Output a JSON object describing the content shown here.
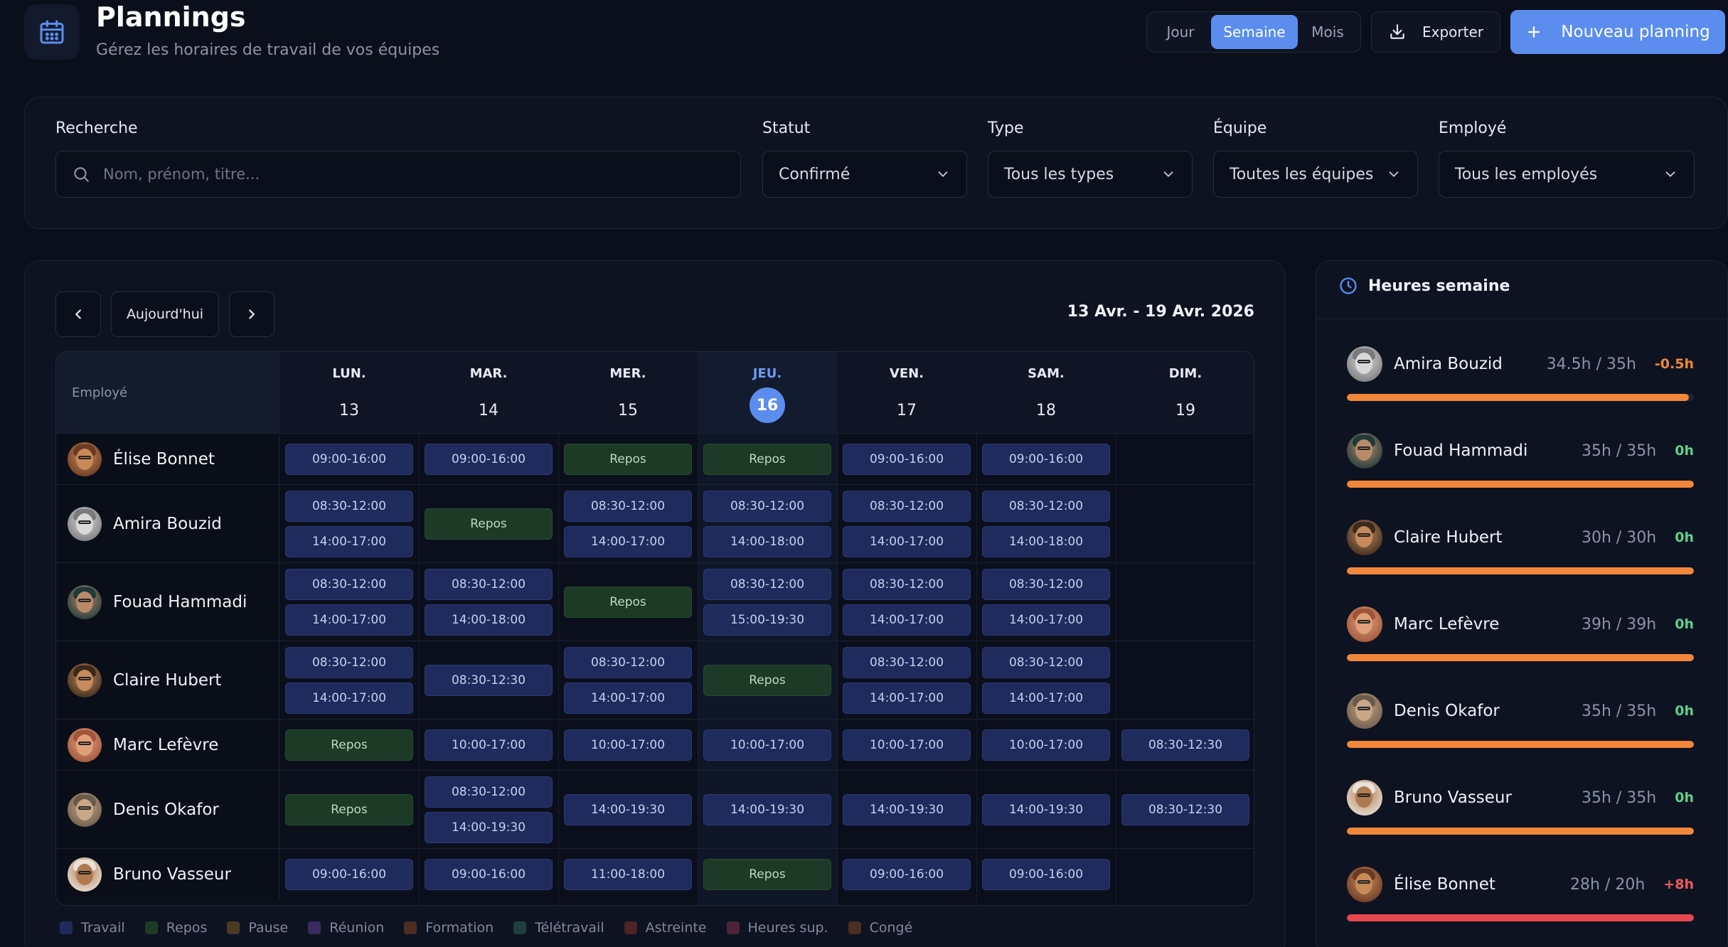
{
  "header": {
    "title": "Plannings",
    "subtitle": "Gérez les horaires de travail de vos équipes",
    "views": [
      "Jour",
      "Semaine",
      "Mois"
    ],
    "active_view": "Semaine",
    "export_label": "Exporter",
    "new_label": "Nouveau planning",
    "accent_color": "#5b8def"
  },
  "filters": {
    "search_label": "Recherche",
    "search_placeholder": "Nom, prénom, titre...",
    "status_label": "Statut",
    "status_value": "Confirmé",
    "type_label": "Type",
    "type_value": "Tous les types",
    "team_label": "Équipe",
    "team_value": "Toutes les équipes",
    "employee_label": "Employé",
    "employee_value": "Tous les employés"
  },
  "calendar": {
    "today_label": "Aujourd'hui",
    "date_range": "13 Avr. - 19 Avr. 2026",
    "employee_header": "Employé",
    "days": [
      {
        "name": "LUN.",
        "num": "13"
      },
      {
        "name": "MAR.",
        "num": "14"
      },
      {
        "name": "MER.",
        "num": "15"
      },
      {
        "name": "JEU.",
        "num": "16",
        "today": true
      },
      {
        "name": "VEN.",
        "num": "17"
      },
      {
        "name": "SAM.",
        "num": "18"
      },
      {
        "name": "DIM.",
        "num": "19"
      }
    ],
    "rows": [
      {
        "name": "Élise Bonnet",
        "avatar_colors": [
          "#6b3a22",
          "#c98a5a"
        ],
        "cells": [
          [
            "09:00-16:00"
          ],
          [
            "09:00-16:00"
          ],
          [
            "Repos"
          ],
          [
            "Repos"
          ],
          [
            "09:00-16:00"
          ],
          [
            "09:00-16:00"
          ],
          []
        ]
      },
      {
        "name": "Amira Bouzid",
        "avatar_colors": [
          "#7a7a7a",
          "#d9d9d9"
        ],
        "cells": [
          [
            "08:30-12:00",
            "14:00-17:00"
          ],
          [
            "Repos"
          ],
          [
            "08:30-12:00",
            "14:00-17:00"
          ],
          [
            "08:30-12:00",
            "14:00-18:00"
          ],
          [
            "08:30-12:00",
            "14:00-17:00"
          ],
          [
            "08:30-12:00",
            "14:00-18:00"
          ],
          []
        ]
      },
      {
        "name": "Fouad Hammadi",
        "avatar_colors": [
          "#1e3a3a",
          "#b98a6a"
        ],
        "cells": [
          [
            "08:30-12:00",
            "14:00-17:00"
          ],
          [
            "08:30-12:00",
            "14:00-18:00"
          ],
          [
            "Repos"
          ],
          [
            "08:30-12:00",
            "15:00-19:30"
          ],
          [
            "08:30-12:00",
            "14:00-17:00"
          ],
          [
            "08:30-12:00",
            "14:00-17:00"
          ],
          []
        ]
      },
      {
        "name": "Claire Hubert",
        "avatar_colors": [
          "#3a2a1a",
          "#c68a5e"
        ],
        "cells": [
          [
            "08:30-12:00",
            "14:00-17:00"
          ],
          [
            "08:30-12:30"
          ],
          [
            "08:30-12:00",
            "14:00-17:00"
          ],
          [
            "Repos"
          ],
          [
            "08:30-12:00",
            "14:00-17:00"
          ],
          [
            "08:30-12:00",
            "14:00-17:00"
          ],
          []
        ]
      },
      {
        "name": "Marc Lefèvre",
        "avatar_colors": [
          "#a0553a",
          "#e0a07a"
        ],
        "cells": [
          [
            "Repos"
          ],
          [
            "10:00-17:00"
          ],
          [
            "10:00-17:00"
          ],
          [
            "10:00-17:00"
          ],
          [
            "10:00-17:00"
          ],
          [
            "10:00-17:00"
          ],
          [
            "08:30-12:30"
          ]
        ]
      },
      {
        "name": "Denis Okafor",
        "avatar_colors": [
          "#6a5a4a",
          "#c8a888"
        ],
        "cells": [
          [
            "Repos"
          ],
          [
            "08:30-12:00",
            "14:00-19:30"
          ],
          [
            "14:00-19:30"
          ],
          [
            "14:00-19:30"
          ],
          [
            "14:00-19:30"
          ],
          [
            "14:00-19:30"
          ],
          [
            "08:30-12:30"
          ]
        ]
      },
      {
        "name": "Bruno Vasseur",
        "avatar_colors": [
          "#e8e2d8",
          "#b07a50"
        ],
        "cells": [
          [
            "09:00-16:00"
          ],
          [
            "09:00-16:00"
          ],
          [
            "11:00-18:00"
          ],
          [
            "Repos"
          ],
          [
            "09:00-16:00"
          ],
          [
            "09:00-16:00"
          ],
          []
        ]
      }
    ],
    "legend": [
      {
        "label": "Travail",
        "color": "#1e2b5c"
      },
      {
        "label": "Repos",
        "color": "#1d3a27"
      },
      {
        "label": "Pause",
        "color": "#4a3a22"
      },
      {
        "label": "Réunion",
        "color": "#3a2a5e"
      },
      {
        "label": "Formation",
        "color": "#4e2e22"
      },
      {
        "label": "Télétravail",
        "color": "#1e3f3c"
      },
      {
        "label": "Astreinte",
        "color": "#4e2226"
      },
      {
        "label": "Heures sup.",
        "color": "#4e2238"
      },
      {
        "label": "Congé",
        "color": "#4a2e1e"
      }
    ]
  },
  "hours": {
    "title": "Heures semaine",
    "items": [
      {
        "name": "Amira Bouzid",
        "value": "34.5h / 35h",
        "diff": "-0.5h",
        "diff_color": "#f0873a",
        "fill": 0.986,
        "bar_color": "#f0873a",
        "avatar_colors": [
          "#7a7a7a",
          "#d9d9d9"
        ]
      },
      {
        "name": "Fouad Hammadi",
        "value": "35h / 35h",
        "diff": "0h",
        "diff_color": "#5fd08a",
        "fill": 1,
        "bar_color": "#f0873a",
        "avatar_colors": [
          "#1e3a3a",
          "#b98a6a"
        ]
      },
      {
        "name": "Claire Hubert",
        "value": "30h / 30h",
        "diff": "0h",
        "diff_color": "#5fd08a",
        "fill": 1,
        "bar_color": "#f0873a",
        "avatar_colors": [
          "#3a2a1a",
          "#c68a5e"
        ]
      },
      {
        "name": "Marc Lefèvre",
        "value": "39h / 39h",
        "diff": "0h",
        "diff_color": "#5fd08a",
        "fill": 1,
        "bar_color": "#f0873a",
        "avatar_colors": [
          "#a0553a",
          "#e0a07a"
        ]
      },
      {
        "name": "Denis Okafor",
        "value": "35h / 35h",
        "diff": "0h",
        "diff_color": "#5fd08a",
        "fill": 1,
        "bar_color": "#f0873a",
        "avatar_colors": [
          "#6a5a4a",
          "#c8a888"
        ]
      },
      {
        "name": "Bruno Vasseur",
        "value": "35h / 35h",
        "diff": "0h",
        "diff_color": "#5fd08a",
        "fill": 1,
        "bar_color": "#f0873a",
        "avatar_colors": [
          "#e8e2d8",
          "#b07a50"
        ]
      },
      {
        "name": "Élise Bonnet",
        "value": "28h / 20h",
        "diff": "+8h",
        "diff_color": "#ef5a5a",
        "fill": 1,
        "bar_color": "#e5484d",
        "avatar_colors": [
          "#6b3a22",
          "#c98a5a"
        ]
      }
    ]
  }
}
